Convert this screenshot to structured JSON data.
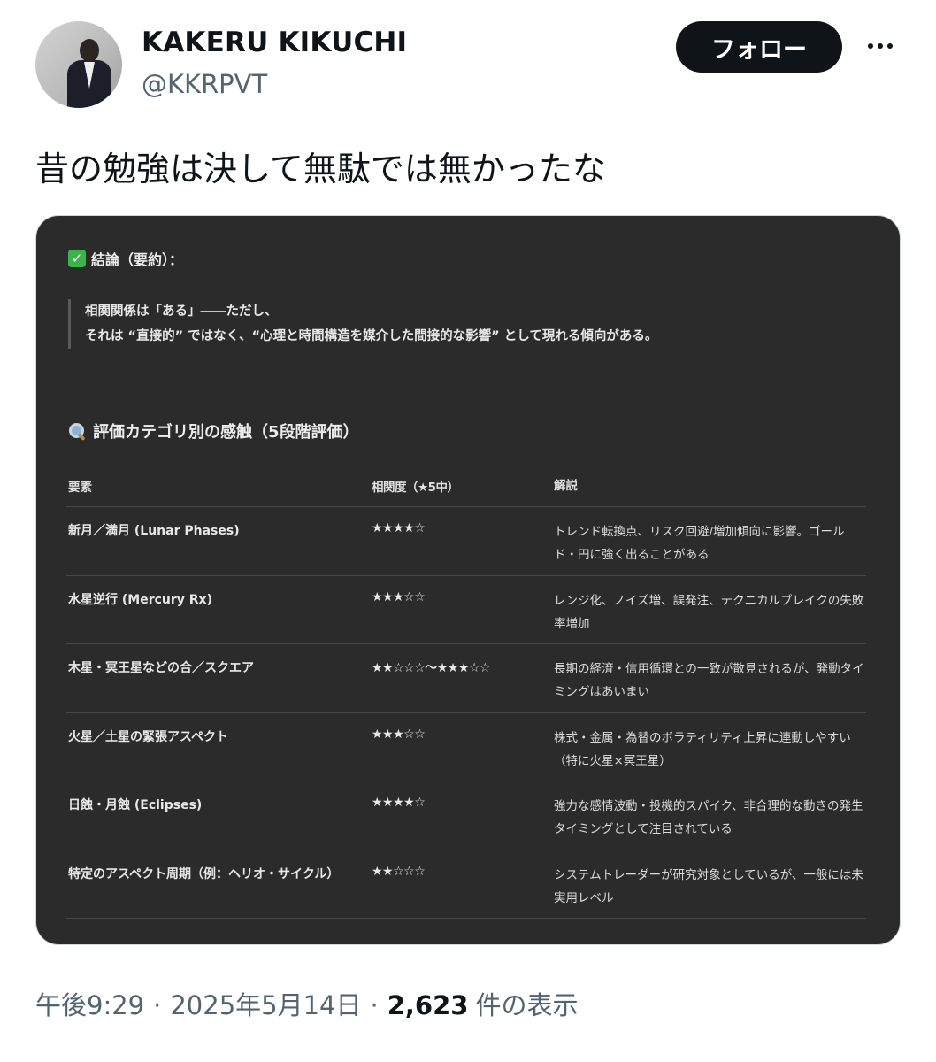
{
  "author": {
    "name": "KAKERU KIKUCHI",
    "handle": "@KKRPVT"
  },
  "follow_label": "フォロー",
  "tweet_text": "昔の勉強は決して無駄では無かったな",
  "card": {
    "conclusion_title": "結論（要約）：",
    "quote_line1": "相関関係は「ある」――ただし、",
    "quote_line2": "それは “直接的” ではなく、“心理と時間構造を媒介した間接的な影響” として現れる傾向がある。",
    "section2_title": "評価カテゴリ別の感触（5段階評価）",
    "table": {
      "headers": [
        "要素",
        "相関度（★5中）",
        "解説"
      ],
      "rows": [
        {
          "factor": "新月／満月 (Lunar Phases)",
          "rating": "★★★★☆",
          "desc": "トレンド転換点、リスク回避/増加傾向に影響。ゴールド・円に強く出ることがある"
        },
        {
          "factor": "水星逆行 (Mercury Rx)",
          "rating": "★★★☆☆",
          "desc": "レンジ化、ノイズ増、誤発注、テクニカルブレイクの失敗率増加"
        },
        {
          "factor": "木星・冥王星などの合／スクエア",
          "rating": "★★☆☆☆〜★★★☆☆",
          "desc": "長期の経済・信用循環との一致が散見されるが、発動タイミングはあいまい"
        },
        {
          "factor": "火星／土星の緊張アスペクト",
          "rating": "★★★☆☆",
          "desc": "株式・金属・為替のボラティリティ上昇に連動しやすい（特に火星×冥王星）"
        },
        {
          "factor": "日蝕・月蝕 (Eclipses)",
          "rating": "★★★★☆",
          "desc": "強力な感情波動・投機的スパイク、非合理的な動きの発生タイミングとして注目されている"
        },
        {
          "factor": "特定のアスペクト周期（例：ヘリオ・サイクル）",
          "rating": "★★☆☆☆",
          "desc": "システムトレーダーが研究対象としているが、一般には未実用レベル"
        }
      ]
    }
  },
  "meta": {
    "time": "午後9:29",
    "separator": "·",
    "date": "2025年5月14日",
    "views_count": "2,623",
    "views_label": "件の表示"
  },
  "colors": {
    "follow_bg": "#0f1419",
    "card_bg": "#2b2b2b",
    "secondary_text": "#536471"
  }
}
